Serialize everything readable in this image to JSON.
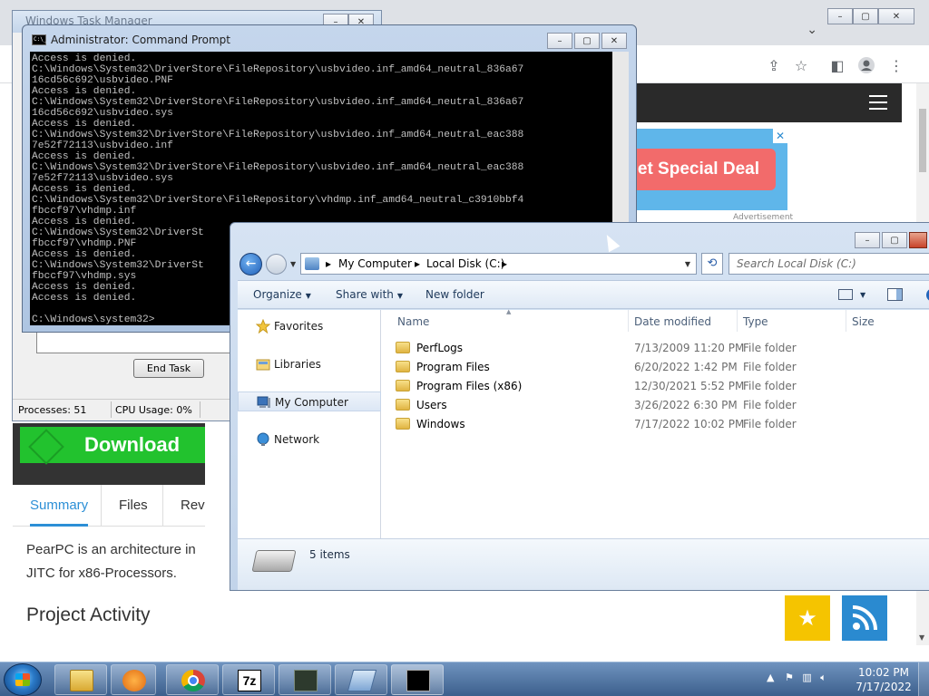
{
  "browser": {
    "ad": {
      "pill_text": "et Special Deal",
      "close": "✕",
      "caption": "Advertisement"
    },
    "download_label": "Download",
    "tabs": [
      "Summary",
      "Files",
      "Rev"
    ],
    "description": [
      "PearPC is an architecture in",
      "JITC for x86-Processors."
    ],
    "section_title": "Project Activity"
  },
  "taskmgr": {
    "title": "Windows Task Manager",
    "end_task": "End Task",
    "processes": "Processes: 51",
    "cpu": "CPU Usage: 0%"
  },
  "cmd": {
    "title": "Administrator: Command Prompt",
    "icon_text": "C:\\_",
    "lines": [
      "Access is denied.",
      "C:\\Windows\\System32\\DriverStore\\FileRepository\\usbvideo.inf_amd64_neutral_836a67",
      "16cd56c692\\usbvideo.PNF",
      "Access is denied.",
      "C:\\Windows\\System32\\DriverStore\\FileRepository\\usbvideo.inf_amd64_neutral_836a67",
      "16cd56c692\\usbvideo.sys",
      "Access is denied.",
      "C:\\Windows\\System32\\DriverStore\\FileRepository\\usbvideo.inf_amd64_neutral_eac388",
      "7e52f72113\\usbvideo.inf",
      "Access is denied.",
      "C:\\Windows\\System32\\DriverStore\\FileRepository\\usbvideo.inf_amd64_neutral_eac388",
      "7e52f72113\\usbvideo.sys",
      "Access is denied.",
      "C:\\Windows\\System32\\DriverStore\\FileRepository\\vhdmp.inf_amd64_neutral_c3910bbf4",
      "fbccf97\\vhdmp.inf",
      "Access is denied.",
      "C:\\Windows\\System32\\DriverSt",
      "fbccf97\\vhdmp.PNF",
      "Access is denied.",
      "C:\\Windows\\System32\\DriverSt",
      "fbccf97\\vhdmp.sys",
      "Access is denied.",
      "Access is denied.",
      "",
      "C:\\Windows\\system32>"
    ]
  },
  "explorer": {
    "breadcrumb": [
      "My Computer",
      "Local Disk (C:)"
    ],
    "search_placeholder": "Search Local Disk (C:)",
    "toolbar": {
      "organize": "Organize",
      "share_with": "Share with",
      "new_folder": "New folder"
    },
    "nav": [
      {
        "label": "Favorites",
        "icon": "star-icon"
      },
      {
        "label": "Libraries",
        "icon": "library-icon"
      },
      {
        "label": "My Computer",
        "icon": "computer-icon"
      },
      {
        "label": "Network",
        "icon": "network-icon"
      }
    ],
    "columns": [
      "Name",
      "Date modified",
      "Type",
      "Size"
    ],
    "files": [
      {
        "name": "PerfLogs",
        "date": "7/13/2009 11:20 PM",
        "type": "File folder"
      },
      {
        "name": "Program Files",
        "date": "6/20/2022 1:42 PM",
        "type": "File folder"
      },
      {
        "name": "Program Files (x86)",
        "date": "12/30/2021 5:52 PM",
        "type": "File folder"
      },
      {
        "name": "Users",
        "date": "3/26/2022 6:30 PM",
        "type": "File folder"
      },
      {
        "name": "Windows",
        "date": "7/17/2022 10:02 PM",
        "type": "File folder"
      }
    ],
    "item_count": "5 items"
  },
  "taskbar": {
    "items": [
      "explorer-icon",
      "media-player-icon",
      "chrome-icon",
      "7zip-icon",
      "task-manager-icon",
      "remote-desktop-icon",
      "cmd-icon"
    ],
    "sevenzip_label": "7z",
    "time": "10:02 PM",
    "date": "7/17/2022"
  }
}
